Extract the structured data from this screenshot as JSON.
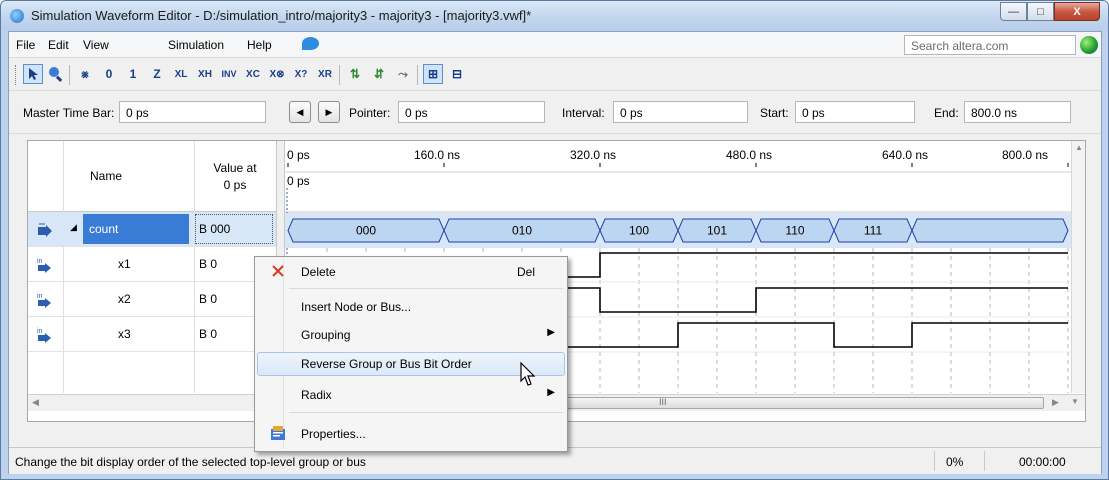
{
  "window": {
    "title": "Simulation Waveform Editor - D:/simulation_intro/majority3 - majority3 - [majority3.vwf]*",
    "min_glyph": "—",
    "max_glyph": "□",
    "close_glyph": "X"
  },
  "menubar": {
    "items": [
      "File",
      "Edit",
      "View",
      "Simulation",
      "Help"
    ],
    "search_placeholder": "Search altera.com"
  },
  "toolbar": {
    "buttons": [
      "pointer-tool",
      "zoom-tool",
      "forcing-unknown",
      "forcing-low",
      "forcing-high",
      "high-impedance",
      "weak-low",
      "weak-high",
      "invert",
      "count-value",
      "clock",
      "arbitrary-value",
      "random-values",
      "overwrite-clock",
      "snap-to-grid",
      "sort",
      "group",
      "ungroup",
      "insert-time",
      "grid-size"
    ]
  },
  "timebar": {
    "master_label": "Master Time Bar:",
    "master_value": "0 ps",
    "pointer_label": "Pointer:",
    "pointer_value": "0 ps",
    "interval_label": "Interval:",
    "interval_value": "0 ps",
    "start_label": "Start:",
    "start_value": "0 ps",
    "end_label": "End:",
    "end_value": "800.0 ns"
  },
  "table": {
    "name_header": "Name",
    "value_header_1": "Value at",
    "value_header_2": "0 ps",
    "rows": [
      {
        "name": "count",
        "value": "B 000",
        "expander": "◢"
      },
      {
        "name": "x1",
        "value": "B 0"
      },
      {
        "name": "x2",
        "value": "B 0"
      },
      {
        "name": "x3",
        "value": "B 0"
      }
    ]
  },
  "timeline": {
    "ticks": [
      "0 ps",
      "160.0 ns",
      "320.0 ns",
      "480.0 ns",
      "640.0 ns",
      "800.0 ns"
    ],
    "cursor_label": "0 ps"
  },
  "bus_values": [
    "000",
    "010",
    "100",
    "101",
    "110",
    "111"
  ],
  "waveforms": {
    "bus_segments": [
      [
        0,
        160
      ],
      [
        160,
        320
      ],
      [
        320,
        400
      ],
      [
        400,
        480
      ],
      [
        480,
        560
      ],
      [
        560,
        640
      ],
      [
        640,
        800
      ]
    ],
    "x1": [
      [
        0,
        0
      ],
      [
        320,
        1
      ],
      [
        800,
        1
      ]
    ],
    "x2": [
      [
        0,
        1
      ],
      [
        320,
        0
      ],
      [
        480,
        1
      ],
      [
        800,
        1
      ]
    ],
    "x3": [
      [
        0,
        0
      ],
      [
        400,
        1
      ],
      [
        560,
        0
      ],
      [
        640,
        1
      ],
      [
        800,
        1
      ]
    ]
  },
  "context_menu": {
    "items": [
      {
        "label": "Delete",
        "shortcut": "Del",
        "icon": "delete-x-icon"
      },
      {
        "label": "Insert Node or Bus..."
      },
      {
        "label": "Grouping",
        "submenu": true
      },
      {
        "label": "Reverse Group or Bus Bit Order",
        "hover": true
      },
      {
        "label": "Radix",
        "submenu": true
      },
      {
        "label": "Properties...",
        "icon": "properties-icon"
      }
    ]
  },
  "hscroll_glyph": "III",
  "status": {
    "message": "Change the bit display order of the selected top-level group or bus",
    "percent": "0%",
    "elapsed": "00:00:00"
  },
  "colors": {
    "selection": "#3a7bd5",
    "bus_fill": "#bcd6f2",
    "bus_stroke": "#1f3fa8",
    "wave": "#000000"
  }
}
